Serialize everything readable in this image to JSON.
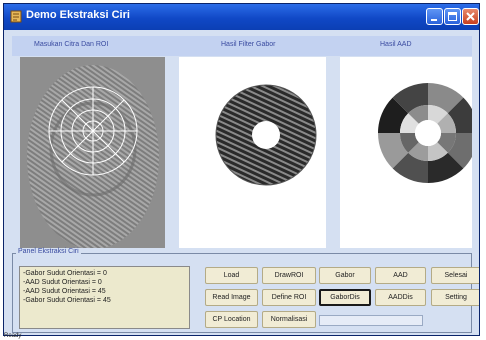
{
  "window": {
    "title": "Demo Ekstraksi Ciri"
  },
  "headers": {
    "input": "Masukan Citra Dan ROI",
    "gabor": "Hasil Filter Gabor",
    "aad": "Hasil AAD"
  },
  "group": {
    "title": "Panel Ekstraksi Ciri"
  },
  "log": [
    "-Gabor Sudut Orientasi  = 0",
    "-AAD Sudut Orientasi    = 0",
    "-AAD Sudut Orientasi    = 45",
    "-Gabor Sudut Orientasi  = 45"
  ],
  "buttons": {
    "load": "Load",
    "drawroi": "DrawROI",
    "gabor": "Gabor",
    "aad": "AAD",
    "selesai": "Selesai",
    "read_image": "Read Image",
    "define_roi": "Define ROI",
    "gabordis": "GaborDis",
    "aaddis": "AADDis",
    "setting": "Setting",
    "cp_location": "CP Location",
    "normalisasi": "Normalisasi"
  },
  "status": "Ready",
  "icons": {
    "app": "app-icon",
    "minimize": "minimize-icon",
    "maximize": "maximize-icon",
    "close": "close-icon"
  },
  "colors": {
    "titlebar": "#1048c6",
    "client": "#d5e0f2",
    "button_face": "#f1ecd5",
    "label_text": "#3a4ba0"
  }
}
